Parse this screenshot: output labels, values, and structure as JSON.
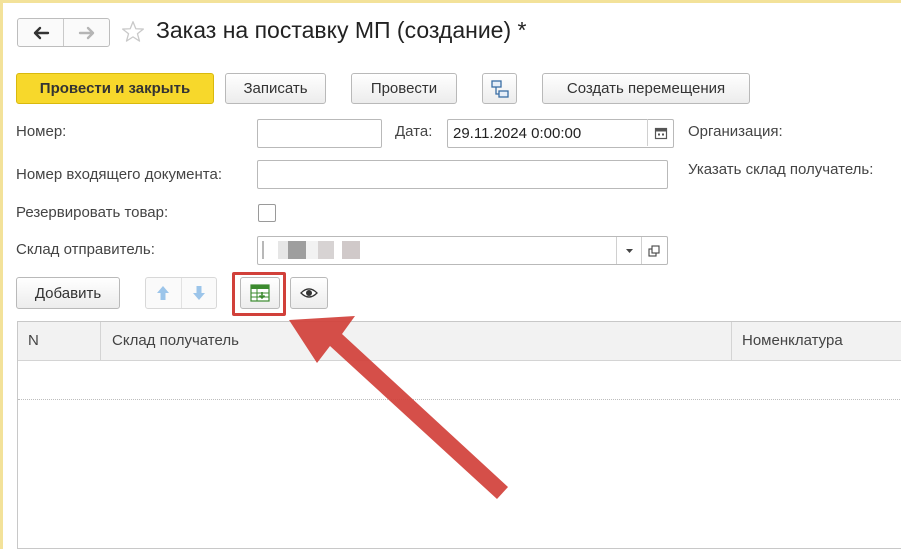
{
  "window": {
    "title": "Заказ на поставку МП (создание) *"
  },
  "toolbar": {
    "post_and_close": "Провести и закрыть",
    "save": "Записать",
    "post": "Провести",
    "structure_icon": "structure-icon",
    "create_transfers": "Создать перемещения"
  },
  "form": {
    "number_label": "Номер:",
    "number_value": "",
    "date_label": "Дата:",
    "date_value": "29.11.2024  0:00:00",
    "organization_label": "Организация:",
    "incoming_doc_label": "Номер входящего документа:",
    "incoming_doc_value": "",
    "specify_receiver_label": "Указать склад получатель:",
    "reserve_label": "Резервировать товар:",
    "reserve_checked": false,
    "sender_warehouse_label": "Склад отправитель:"
  },
  "table_toolbar": {
    "add_label": "Добавить",
    "up_icon": "arrow-up-icon",
    "down_icon": "arrow-down-icon",
    "fill_icon": "table-fill-icon",
    "view_icon": "eye-icon"
  },
  "table": {
    "columns": [
      "N",
      "Склад получатель",
      "Номенклатура"
    ],
    "rows": []
  },
  "colors": {
    "primary_button": "#f7d82b",
    "highlight": "#d1403a",
    "pointer_arrow": "#d1403a"
  }
}
